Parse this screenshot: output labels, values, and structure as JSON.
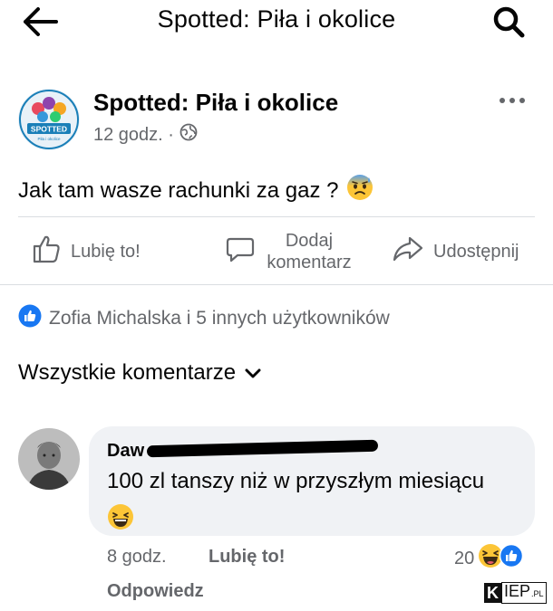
{
  "topbar": {
    "title": "Spotted: Piła i okolice"
  },
  "post": {
    "page_name": "Spotted: Piła i okolice",
    "time": "12 godz. ·",
    "privacy_icon": "globe-icon",
    "text": "Jak tam wasze rachunki za gaz ?",
    "text_emoji": "anxious-sweat-emoji",
    "avatar_logo_text": "SPOTTED",
    "avatar_logo_subtext": "Piła i okolice"
  },
  "actions": {
    "like": "Lubię to!",
    "comment": "Dodaj\nkomentarz",
    "share": "Udostępnij"
  },
  "reactions": {
    "summary": "Zofia Michalska i 5 innych użytkowników"
  },
  "comments_filter": {
    "label": "Wszystkie komentarze"
  },
  "comment": {
    "author_visible": "Daw",
    "author_redacted": true,
    "text": "100 zl tanszy niż w przyszłym miesiącu",
    "text_emoji": "grinning-squinting-emoji",
    "time": "8 godz.",
    "like_label": "Lubię to!",
    "reply_label": "Odpowiedz",
    "reaction_count": "20"
  },
  "watermark": {
    "k": "K",
    "rest": "IEP",
    "suffix": ".PL"
  },
  "colors": {
    "facebook_blue": "#1877f2",
    "secondary_text": "#65676b",
    "bubble_bg": "#f0f2f5",
    "divider": "#dadde1"
  }
}
